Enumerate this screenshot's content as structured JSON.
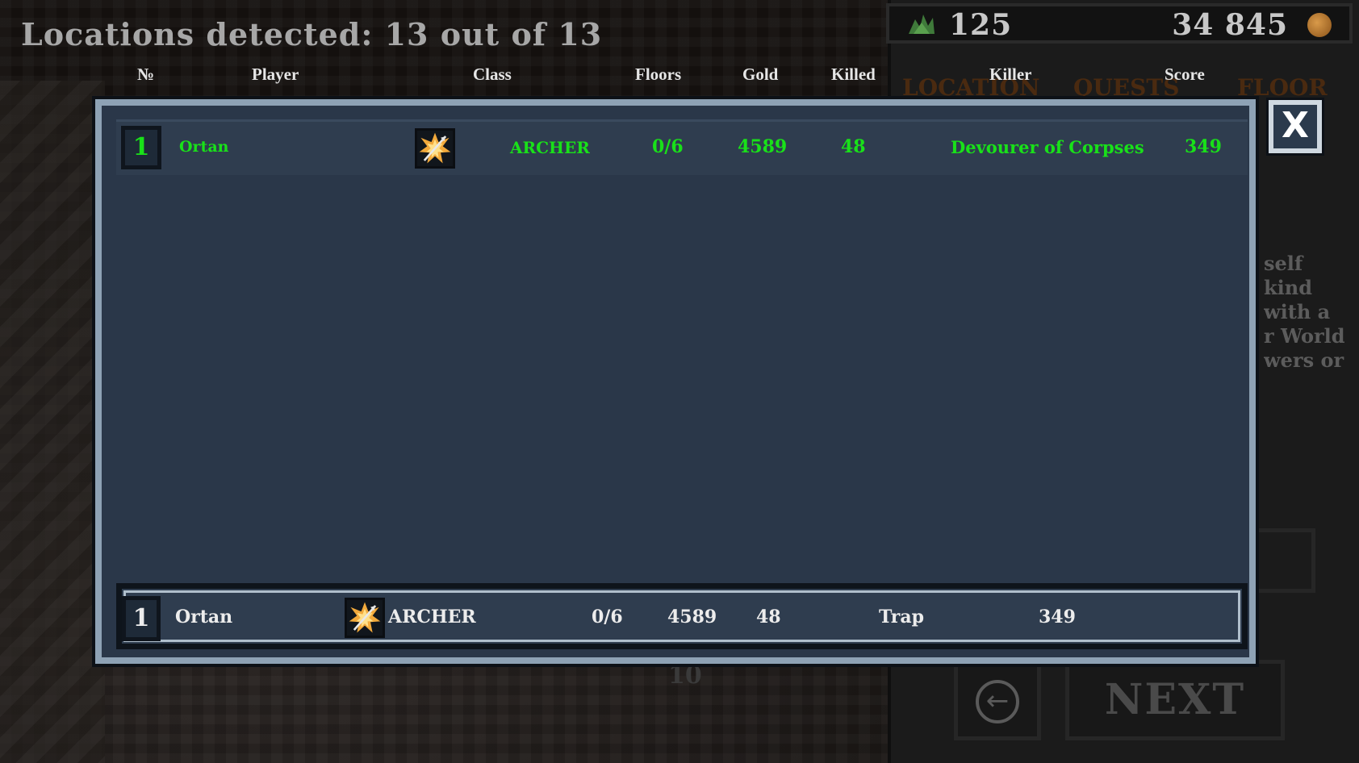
{
  "header": {
    "locations_label": "Locations detected: 13 out of 13"
  },
  "resources": {
    "herbs": "125",
    "gold": "34 845"
  },
  "tabs_behind": [
    "LOCATION",
    "QUESTS",
    "FLOOR"
  ],
  "side_text_behind": "self\nkind\nwith a\nr World\nwers or",
  "background_floor_number": "10",
  "columns": {
    "num": "№",
    "player": "Player",
    "class": "Class",
    "floors": "Floors",
    "gold": "Gold",
    "killed": "Killed",
    "killer": "Killer",
    "score": "Score"
  },
  "rows": [
    {
      "rank": "1",
      "player": "Ortan",
      "class": "ARCHER",
      "floors": "0/6",
      "gold": "4589",
      "killed": "48",
      "killer": "Devourer of Corpses",
      "score": "349"
    }
  ],
  "my_result": {
    "rank": "1",
    "player": "Ortan",
    "class": "ARCHER",
    "floors": "0/6",
    "gold": "4589",
    "killed": "48",
    "killer": "Trap",
    "score": "349"
  },
  "buttons": {
    "close": "X",
    "next": "NEXT"
  },
  "colors": {
    "highlight_green": "#19e119",
    "modal_bg": "#2a3749",
    "modal_border": "#8ea2b5"
  }
}
